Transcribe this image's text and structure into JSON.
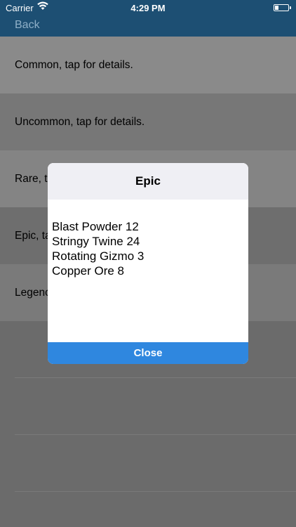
{
  "status_bar": {
    "carrier": "Carrier",
    "time": "4:29 PM"
  },
  "nav": {
    "back_label": "Back"
  },
  "list": {
    "rows": [
      {
        "label": "Common, tap for details."
      },
      {
        "label": "Uncommon, tap for details."
      },
      {
        "label": "Rare, t"
      },
      {
        "label": "Epic, ta"
      },
      {
        "label": "Legenc"
      }
    ]
  },
  "modal": {
    "title": "Epic",
    "lines": [
      "Blast Powder 12",
      "Stringy Twine 24",
      "Rotating Gizmo 3",
      "Copper Ore 8"
    ],
    "close_label": "Close"
  },
  "colors": {
    "nav_bar": "#1d4f73",
    "modal_button": "#2f87df",
    "overlay": "#6b6b6b"
  }
}
